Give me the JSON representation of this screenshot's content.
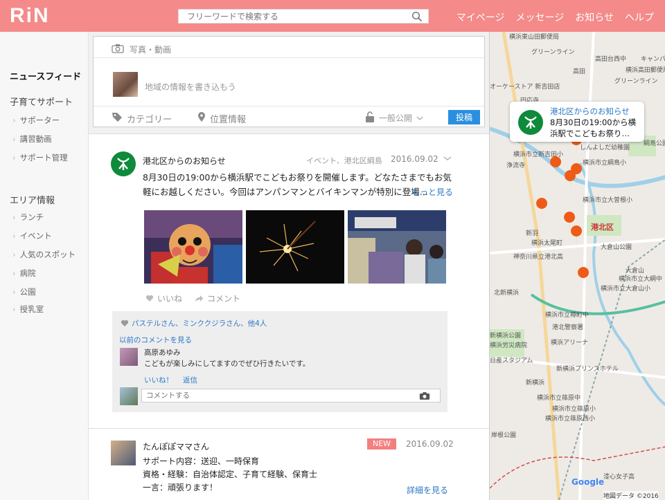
{
  "header": {
    "logo": "RiN",
    "search_placeholder": "フリーワードで検索する",
    "nav": [
      "マイページ",
      "メッセージ",
      "お知らせ",
      "ヘルプ"
    ]
  },
  "sidebar": {
    "feed": "ニュースフィード",
    "support_title": "子育てサポート",
    "support_items": [
      "サポーター",
      "講習動画",
      "サポート管理"
    ],
    "area_title": "エリア情報",
    "area_items": [
      "ランチ",
      "イベント",
      "人気のスポット",
      "病院",
      "公園",
      "授乳室"
    ]
  },
  "composer": {
    "media_label": "写真・動画",
    "placeholder": "地域の情報を書き込もう",
    "category": "カテゴリー",
    "location": "位置情報",
    "visibility": "一般公開",
    "submit": "投稿"
  },
  "post1": {
    "author": "港北区からのお知らせ",
    "meta": "イベント、港北区綱島",
    "date": "2016.09.02",
    "body": "8月30日の19:00から横浜駅でこどもお祭りを開催します。どなたさまでもお気軽にお越しください。今回はアンパンマンとバイキンマンが特別に登場...",
    "more": "もっと見る",
    "like": "いいね",
    "comment": "コメント",
    "likers": "パステルさん、ミンククジラさん、他4人",
    "prev_comments": "以前のコメントを見る",
    "comment_name": "高原あゆみ",
    "comment_text": "こどもが楽しみにしてますのでぜひ行きたいです。",
    "comment_like": "いいね！",
    "comment_reply": "返信",
    "comment_placeholder": "コメントする"
  },
  "post2": {
    "author": "たんぽぽママさん",
    "badge": "NEW",
    "date": "2016.09.02",
    "line1": "サポート内容：送迎、一時保育",
    "line2": "資格・経験：自治体認定、子育て経験、保育士",
    "line3": "一言：頑張ります！",
    "more": "詳細を見る"
  },
  "map": {
    "popup_title": "港北区からのお知らせ",
    "popup_text": "8月30日の19:00から横浜駅でこどもお祭り…",
    "labels": [
      "横浜東山田郵便局",
      "グリーンライン",
      "高田台西中",
      "キャンパ",
      "高田",
      "横浜高田郵便局",
      "グリーンライン",
      "オーケーストア 新吉田店",
      "円応寺",
      "港北区からのお知らせ",
      "しんよしだ幼稚園",
      "綱島公園",
      "横浜市立新吉田小",
      "横浜市立綱島小",
      "浄流寺",
      "横浜市立大曽根小",
      "新羽",
      "港北区",
      "大倉山公園",
      "横浜太尾町",
      "神奈川県立港北高",
      "大倉山",
      "横浜市立大綱中",
      "横浜市立大倉山小",
      "北新横浜",
      "横浜市立樽町中",
      "横浜労災病院",
      "港北警察署",
      "新横浜公園",
      "日産スタジアム",
      "横浜アリーナ",
      "新横浜",
      "新横浜プリンスホテル",
      "横浜市立篠原中",
      "横浜市立篠原小",
      "横浜市立篠原西小",
      "岸根公園",
      "漆心女子高",
      "地図データ ©2016",
      "Google"
    ],
    "attribution": "地図データ ©2016",
    "google": "Google"
  }
}
